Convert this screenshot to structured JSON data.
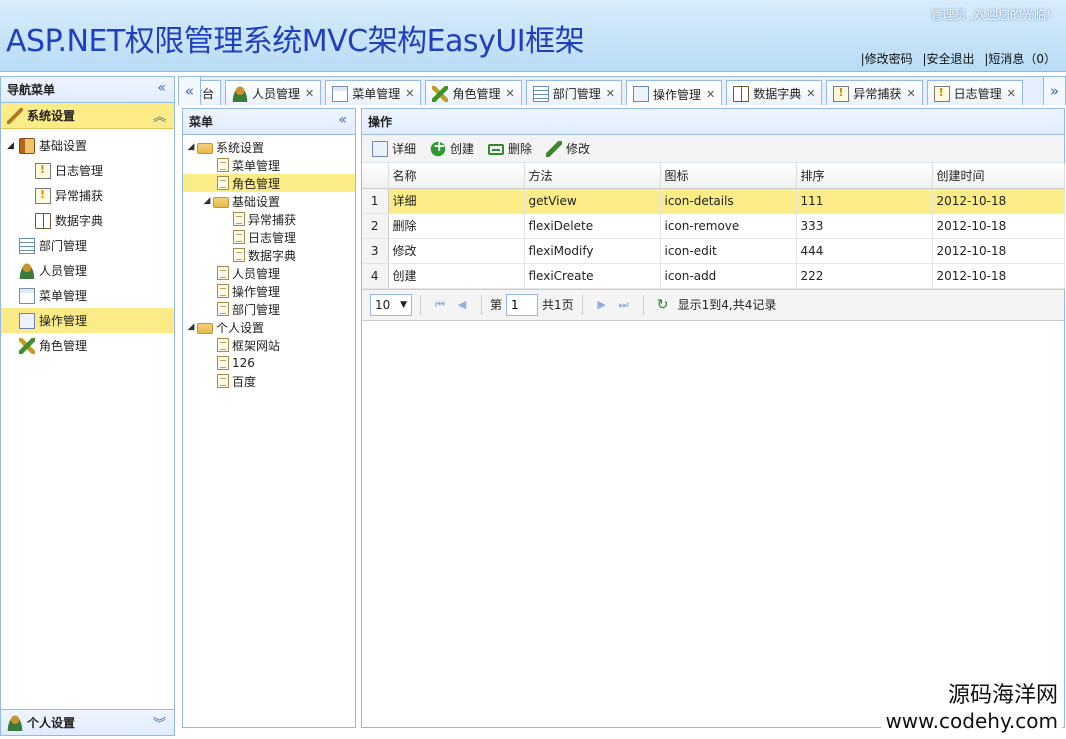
{
  "header": {
    "title": "ASP.NET权限管理系统MVC架构EasyUI框架",
    "welcome": "管理员 ,欢迎您的光临！",
    "links": [
      "|修改密码",
      "|安全退出",
      "|短消息（0）"
    ]
  },
  "nav": {
    "title": "导航菜单",
    "section_title": "系统设置",
    "bottom_section_title": "个人设置",
    "items": [
      {
        "label": "基础设置",
        "icon": "book-icon"
      },
      {
        "label": "日志管理",
        "icon": "log-icon"
      },
      {
        "label": "异常捕获",
        "icon": "warning-icon"
      },
      {
        "label": "数据字典",
        "icon": "dictionary-icon"
      },
      {
        "label": "部门管理",
        "icon": "department-icon"
      },
      {
        "label": "人员管理",
        "icon": "user-icon"
      },
      {
        "label": "菜单管理",
        "icon": "menu-icon"
      },
      {
        "label": "操作管理",
        "icon": "operation-icon"
      },
      {
        "label": "角色管理",
        "icon": "role-icon"
      }
    ]
  },
  "tabs": [
    {
      "label": "工作台"
    },
    {
      "label": "人员管理"
    },
    {
      "label": "菜单管理"
    },
    {
      "label": "角色管理"
    },
    {
      "label": "部门管理"
    },
    {
      "label": "操作管理"
    },
    {
      "label": "数据字典"
    },
    {
      "label": "异常捕获"
    },
    {
      "label": "日志管理"
    }
  ],
  "menu_panel": {
    "title": "菜单",
    "tree": [
      {
        "label": "系统设置"
      },
      {
        "label": "菜单管理"
      },
      {
        "label": "角色管理"
      },
      {
        "label": "基础设置"
      },
      {
        "label": "异常捕获"
      },
      {
        "label": "日志管理"
      },
      {
        "label": "数据字典"
      },
      {
        "label": "人员管理"
      },
      {
        "label": "操作管理"
      },
      {
        "label": "部门管理"
      },
      {
        "label": "个人设置"
      },
      {
        "label": "框架网站"
      },
      {
        "label": "126"
      },
      {
        "label": "百度"
      }
    ]
  },
  "op_panel": {
    "title": "操作",
    "toolbar": {
      "detail": "详细",
      "create": "创建",
      "delete": "删除",
      "modify": "修改"
    },
    "columns": [
      "名称",
      "方法",
      "图标",
      "排序",
      "创建时间"
    ],
    "rows": [
      {
        "n": "1",
        "name": "详细",
        "method": "getView",
        "icon": "icon-details",
        "sort": "111",
        "created": "2012-10-18"
      },
      {
        "n": "2",
        "name": "删除",
        "method": "flexiDelete",
        "icon": "icon-remove",
        "sort": "333",
        "created": "2012-10-18"
      },
      {
        "n": "3",
        "name": "修改",
        "method": "flexiModify",
        "icon": "icon-edit",
        "sort": "444",
        "created": "2012-10-18"
      },
      {
        "n": "4",
        "name": "创建",
        "method": "flexiCreate",
        "icon": "icon-add",
        "sort": "222",
        "created": "2012-10-18"
      }
    ],
    "pager": {
      "page_size": "10",
      "page_prefix": "第",
      "page_value": "1",
      "page_suffix": "共1页",
      "info": "显示1到4,共4记录"
    }
  },
  "watermark": {
    "cn": "源码海洋网",
    "url": "www.codehy.com"
  }
}
